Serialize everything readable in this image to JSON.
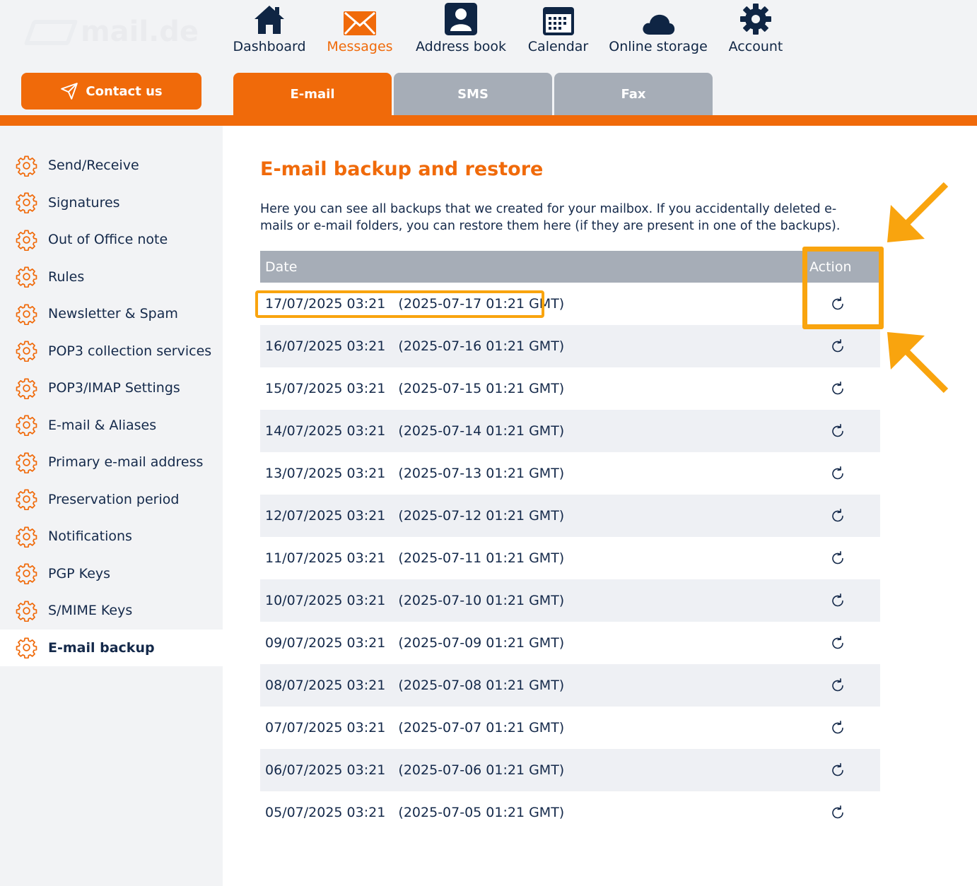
{
  "brand": {
    "logo_text": "mail.de"
  },
  "contact_button": {
    "label": "Contact us"
  },
  "nav": [
    {
      "label": "Dashboard",
      "icon": "home-icon"
    },
    {
      "label": "Messages",
      "icon": "envelope-icon"
    },
    {
      "label": "Address book",
      "icon": "contact-card-icon"
    },
    {
      "label": "Calendar",
      "icon": "calendar-icon"
    },
    {
      "label": "Online storage",
      "icon": "cloud-icon"
    },
    {
      "label": "Account",
      "icon": "gear-icon"
    }
  ],
  "active_nav": "Messages",
  "tabs": [
    {
      "label": "E-mail",
      "active": true
    },
    {
      "label": "SMS",
      "active": false
    },
    {
      "label": "Fax",
      "active": false
    }
  ],
  "sidebar": {
    "items": [
      {
        "label": "Send/Receive"
      },
      {
        "label": "Signatures"
      },
      {
        "label": "Out of Office note"
      },
      {
        "label": "Rules"
      },
      {
        "label": "Newsletter & Spam"
      },
      {
        "label": "POP3 collection services"
      },
      {
        "label": "POP3/IMAP Settings"
      },
      {
        "label": "E-mail & Aliases"
      },
      {
        "label": "Primary e-mail address"
      },
      {
        "label": "Preservation period"
      },
      {
        "label": "Notifications"
      },
      {
        "label": "PGP Keys"
      },
      {
        "label": "S/MIME Keys"
      },
      {
        "label": "E-mail backup",
        "active": true
      }
    ]
  },
  "main": {
    "title": "E-mail backup and restore",
    "intro": "Here you can see all backups that we created for your mailbox. If you accidentally deleted e-mails or e-mail folders, you can restore them here (if they are present in one of the backups).",
    "table": {
      "headers": {
        "date": "Date",
        "action": "Action"
      },
      "rows": [
        {
          "date": "17/07/2025 03:21   (2025-07-17 01:21 GMT)"
        },
        {
          "date": "16/07/2025 03:21   (2025-07-16 01:21 GMT)"
        },
        {
          "date": "15/07/2025 03:21   (2025-07-15 01:21 GMT)"
        },
        {
          "date": "14/07/2025 03:21   (2025-07-14 01:21 GMT)"
        },
        {
          "date": "13/07/2025 03:21   (2025-07-13 01:21 GMT)"
        },
        {
          "date": "12/07/2025 03:21   (2025-07-12 01:21 GMT)"
        },
        {
          "date": "11/07/2025 03:21   (2025-07-11 01:21 GMT)"
        },
        {
          "date": "10/07/2025 03:21   (2025-07-10 01:21 GMT)"
        },
        {
          "date": "09/07/2025 03:21   (2025-07-09 01:21 GMT)"
        },
        {
          "date": "08/07/2025 03:21   (2025-07-08 01:21 GMT)"
        },
        {
          "date": "07/07/2025 03:21   (2025-07-07 01:21 GMT)"
        },
        {
          "date": "06/07/2025 03:21   (2025-07-06 01:21 GMT)"
        },
        {
          "date": "05/07/2025 03:21   (2025-07-05 01:21 GMT)"
        }
      ],
      "action_icon": "restore-icon"
    }
  },
  "colors": {
    "accent": "#f06a0a",
    "navy": "#0f2544",
    "header_gray": "#a6adb7",
    "highlight": "#f9a40e"
  }
}
